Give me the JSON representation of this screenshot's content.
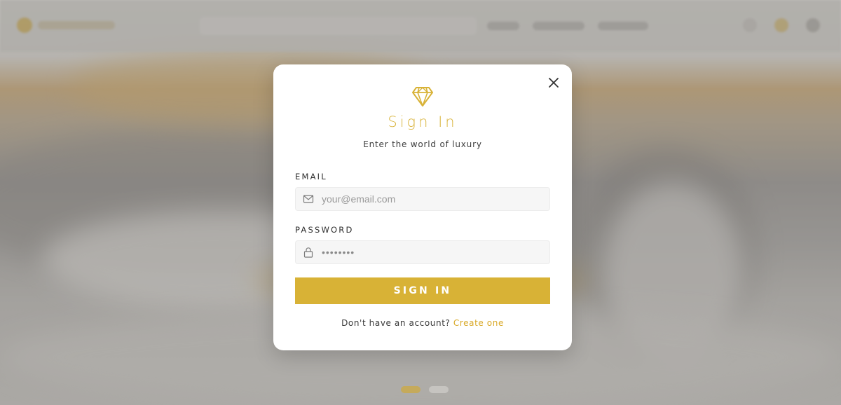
{
  "modal": {
    "title": "Sign In",
    "subtitle": "Enter the world of luxury",
    "email": {
      "label": "EMAIL",
      "placeholder": "your@email.com",
      "value": ""
    },
    "password": {
      "label": "PASSWORD",
      "placeholder": "••••••••",
      "value": ""
    },
    "submit_label": "SIGN IN",
    "footer_text": "Don't have an account?",
    "footer_link": "Create one"
  },
  "icons": {
    "logo": "diamond-icon",
    "close": "close-icon",
    "email": "mail-icon",
    "password": "lock-icon"
  },
  "colors": {
    "accent": "#d8b236",
    "title": "#d9b43c",
    "link": "#d9a928",
    "modal_bg": "#ffffff"
  }
}
